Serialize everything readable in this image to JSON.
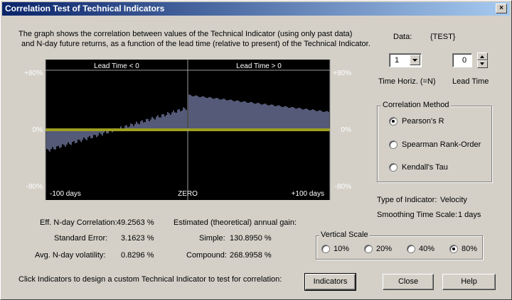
{
  "window": {
    "title": "Correlation Test of Technical Indicators",
    "close_glyph": "×"
  },
  "description": {
    "line1": "The graph shows the correlation between values of the Technical Indicator (using only past data)",
    "line2": "and N-day future returns, as a function of the lead time (relative to present) of the Technical Indicator."
  },
  "data_label": "Data:",
  "data_value": "{TEST}",
  "time_horiz": {
    "value": "1",
    "label": "Time Horiz. (=N)"
  },
  "lead_time": {
    "value": "0",
    "label": "Lead Time"
  },
  "correlation_method": {
    "label": "Correlation Method",
    "options": [
      "Pearson's R",
      "Spearman Rank-Order",
      "Kendall's Tau"
    ],
    "selected": 0
  },
  "indicator_info": {
    "type_label": "Type of Indicator:",
    "type_value": "Velocity",
    "smoothing_label": "Smoothing Time Scale:",
    "smoothing_value": "1 days"
  },
  "vertical_scale": {
    "label": "Vertical Scale",
    "options": [
      "10%",
      "20%",
      "40%",
      "80%"
    ],
    "selected": 3
  },
  "stats": {
    "eff_corr_label": "Eff. N-day Correlation:",
    "eff_corr_value": "49.2563 %",
    "std_err_label": "Standard Error:",
    "std_err_value": "3.1623 %",
    "vol_label": "Avg. N-day volatility:",
    "vol_value": "0.8296 %",
    "gain_label": "Estimated (theoretical) annual gain:",
    "simple_label": "Simple:",
    "simple_value": "130.8950 %",
    "compound_label": "Compound:",
    "compound_value": "268.9958 %"
  },
  "footer_text": "Click Indicators to design a custom Technical Indicator to test for correlation:",
  "buttons": {
    "indicators": "Indicators",
    "close": "Close",
    "help": "Help"
  },
  "colors": {
    "chart_bg": "#000000",
    "bars": "#a8b4ee",
    "zero_line": "#9ea020",
    "title_bar": "#0a246a"
  },
  "chart_data": {
    "type": "bar",
    "region_labels": [
      "Lead Time < 0",
      "Lead Time > 0"
    ],
    "x_tick_labels": [
      "-100 days",
      "ZERO",
      "+100 days"
    ],
    "y_tick_labels": [
      "+80%",
      "0%",
      "-80%"
    ],
    "ylim": [
      -80,
      80
    ],
    "xlim": [
      -100,
      100
    ],
    "series": [
      {
        "x_start": -100,
        "x_end": 0,
        "y_start": -30,
        "y_end": 31
      },
      {
        "x_start": 0,
        "x_end": 100,
        "y_start": 49,
        "y_end": 25
      }
    ]
  }
}
